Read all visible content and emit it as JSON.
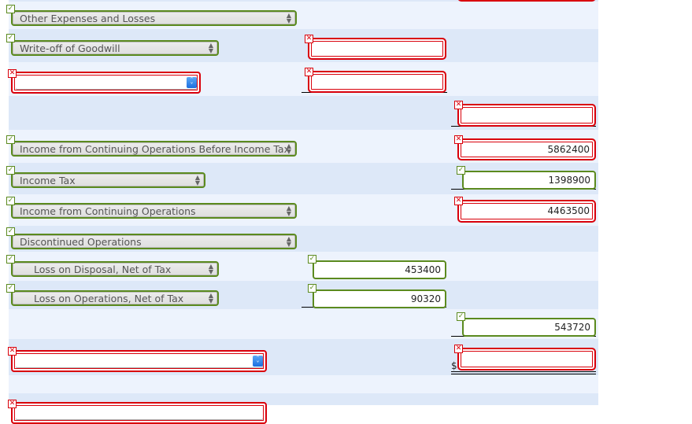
{
  "rows": {
    "other_expenses": {
      "label": "Other Expenses and Losses",
      "status": "correct"
    },
    "goodwill": {
      "label": "Write-off of Goodwill",
      "status": "correct",
      "amount": "",
      "amount_status": "incorrect"
    },
    "blank_select_1": {
      "label": "",
      "status": "incorrect",
      "amount": "",
      "amount_status": "incorrect"
    },
    "subtotal_1": {
      "amount": "",
      "amount_status": "incorrect"
    },
    "income_before_tax": {
      "label": "Income from Continuing Operations Before Income Tax",
      "status": "correct",
      "amount": "5862400",
      "amount_status": "incorrect"
    },
    "income_tax": {
      "label": "Income Tax",
      "status": "correct",
      "amount": "1398900",
      "amount_status": "correct"
    },
    "income_continuing": {
      "label": "Income from Continuing Operations",
      "status": "correct",
      "amount": "4463500",
      "amount_status": "incorrect"
    },
    "discontinued": {
      "label": "Discontinued Operations",
      "status": "correct"
    },
    "loss_disposal": {
      "label": "Loss on Disposal, Net of Tax",
      "status": "correct",
      "amount": "453400",
      "amount_status": "correct"
    },
    "loss_operations": {
      "label": "Loss on Operations, Net of Tax",
      "status": "correct",
      "amount": "90320",
      "amount_status": "correct"
    },
    "discontinued_total": {
      "amount": "543720",
      "amount_status": "correct"
    },
    "blank_select_2": {
      "label": "",
      "status": "incorrect",
      "currency": "$",
      "amount": "",
      "amount_status": "incorrect"
    },
    "blank_select_3": {
      "label": "",
      "status": "incorrect"
    }
  },
  "icons": {
    "correct": "✓",
    "incorrect": "✕",
    "select_arrows": "▲▼",
    "blue_select_arrows": "⌃⌄"
  },
  "colors": {
    "correct": "#5b8a1e",
    "incorrect": "#d9000b",
    "row_light": "#edf3fd",
    "row_dark": "#dde8f8"
  }
}
